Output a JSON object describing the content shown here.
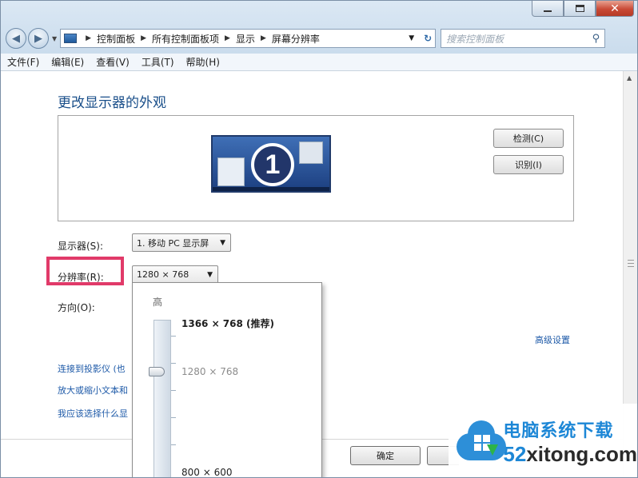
{
  "window": {
    "caption_min": "",
    "caption_max": "",
    "caption_close": "✕"
  },
  "nav": {
    "address_crumbs": [
      "控制面板",
      "所有控制面板项",
      "显示",
      "屏幕分辨率"
    ],
    "search_placeholder": "搜索控制面板"
  },
  "menu": [
    "文件(F)",
    "编辑(E)",
    "查看(V)",
    "工具(T)",
    "帮助(H)"
  ],
  "main": {
    "title": "更改显示器的外观",
    "monitor_number": "1",
    "detect_label": "检测(C)",
    "identify_label": "识别(I)",
    "display_label": "显示器(S):",
    "display_value": "1. 移动 PC 显示屏",
    "resolution_label": "分辨率(R):",
    "resolution_value": "1280 × 768",
    "orientation_label": "方向(O):",
    "advanced_link": "高级设置",
    "links": [
      "连接到投影仪 (也",
      "放大或缩小文本和",
      "我应该选择什么显"
    ],
    "ok_label": "确定"
  },
  "resolution_dropdown": {
    "high_label": "高",
    "options": [
      "1366 × 768 (推荐)",
      "1280 × 768",
      "800 × 600"
    ],
    "selected_value": "1280 × 768"
  },
  "watermark": {
    "cn": "电脑系统下载",
    "en_prefix": "52",
    "en_rest": "xitong.com"
  }
}
